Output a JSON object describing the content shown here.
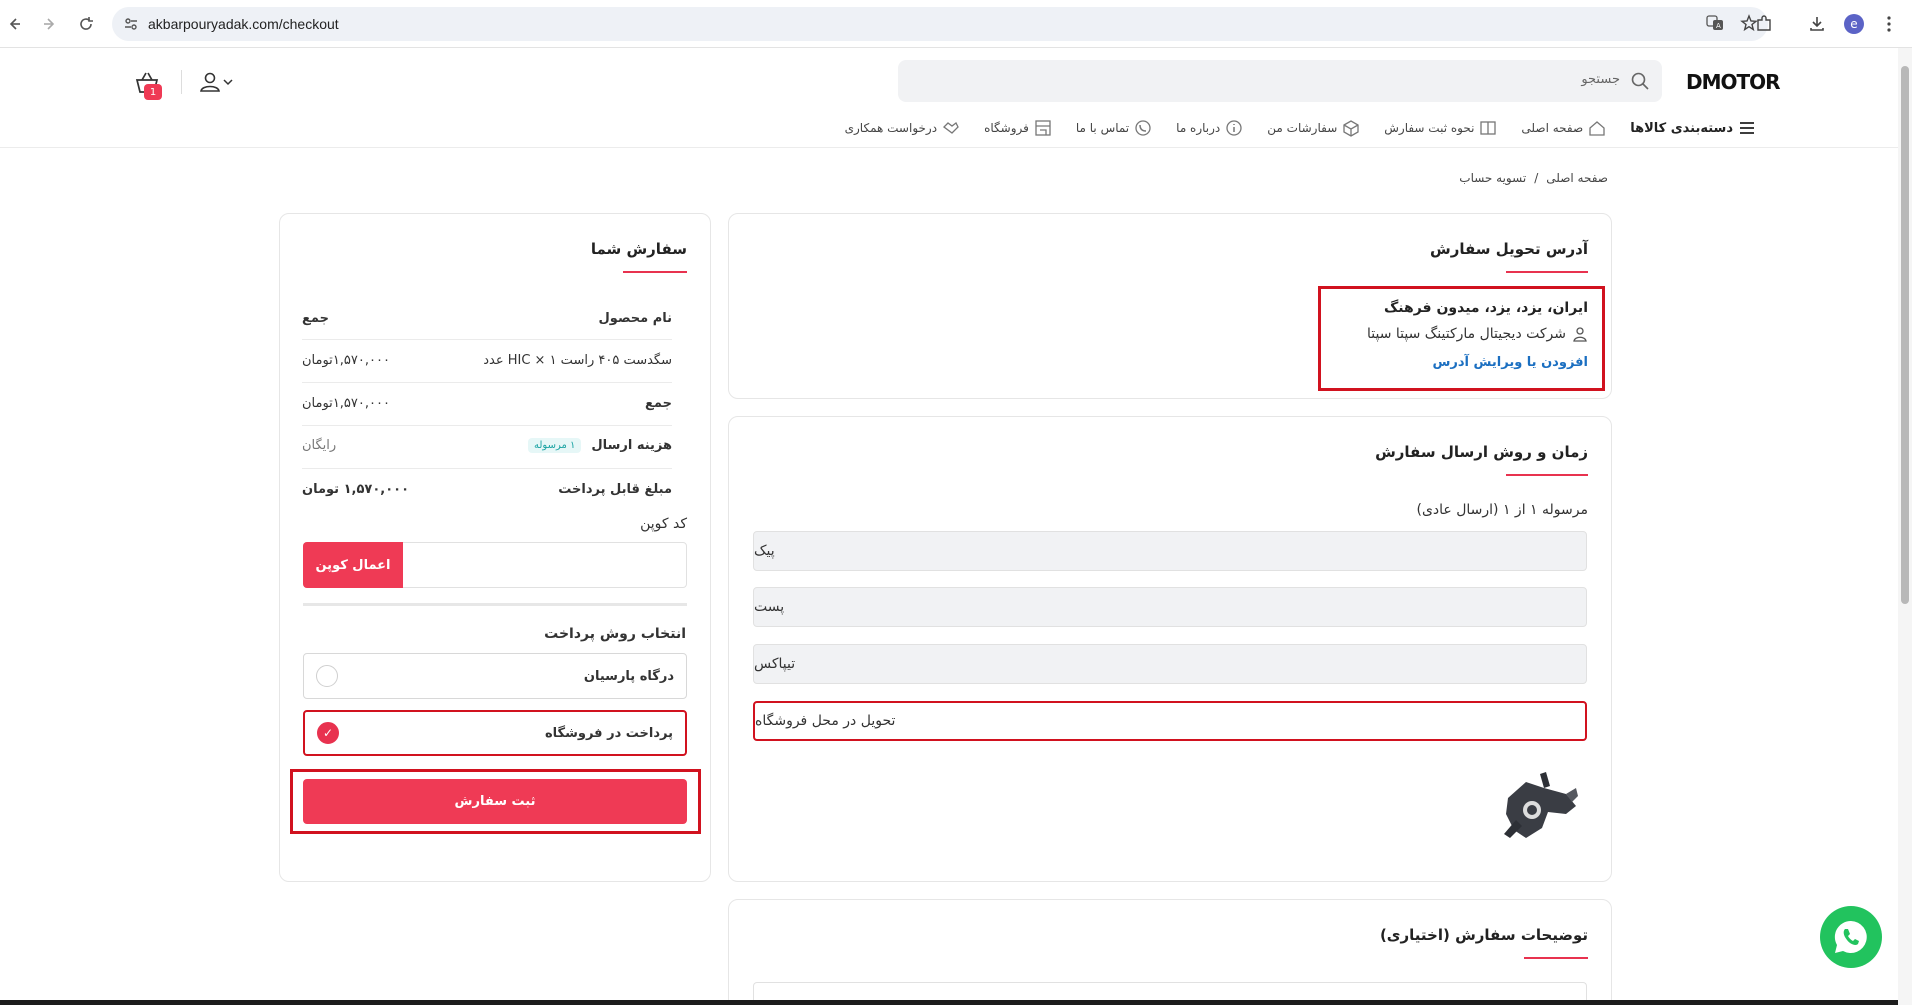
{
  "browser": {
    "url": "akbarpouryadak.com/checkout",
    "profile_initial": "e"
  },
  "header": {
    "logo_text": "DMOTOR",
    "search_placeholder": "جستجو",
    "cart_count": "1"
  },
  "menu": {
    "categories": "دسته‌بندی کالاها",
    "items": [
      {
        "label": "صفحه اصلی",
        "icon": "home-icon"
      },
      {
        "label": "نحوه ثبت سفارش",
        "icon": "book-icon"
      },
      {
        "label": "سفارشات من",
        "icon": "box-icon"
      },
      {
        "label": "درباره ما",
        "icon": "info-icon"
      },
      {
        "label": "تماس با ما",
        "icon": "phone-icon"
      },
      {
        "label": "فروشگاه",
        "icon": "store-icon"
      },
      {
        "label": "درخواست همکاری",
        "icon": "handshake-icon"
      }
    ]
  },
  "breadcrumb": {
    "home": "صفحه اصلی",
    "separator": "/",
    "current": "تسویه حساب"
  },
  "address": {
    "title": "آدرس تحویل سفارش",
    "line1": "ایران، یزد، یزد، میدون فرهنگ",
    "recipient": "شرکت دیجیتال مارکتینگ سپتا سپتا",
    "edit_link": "افزودن یا ویرایش آدرس"
  },
  "shipping": {
    "title": "زمان و روش ارسال سفارش",
    "shipment_label": "مرسوله ۱ از ۱ (ارسال عادی)",
    "options": [
      "پیک",
      "پست",
      "تیپاکس",
      "تحویل در محل فروشگاه"
    ],
    "selected_index": 3
  },
  "notes": {
    "title": "توضیحات سفارش (اختیاری)"
  },
  "order": {
    "title": "سفارش شما",
    "header": {
      "product": "نام محصول",
      "total": "جمع"
    },
    "product": {
      "name": "سگدست ۴۰۵ راست HIC × ۱ عدد",
      "price": "۱,۵۷۰,۰۰۰تومان"
    },
    "subtotal": {
      "label": "جمع",
      "value": "۱,۵۷۰,۰۰۰تومان"
    },
    "shipping_cost": {
      "label": "هزینه ارسال",
      "badge": "۱ مرسوله",
      "value": "رایگان"
    },
    "payable": {
      "label": "مبلغ قابل پرداخت",
      "value": "۱,۵۷۰,۰۰۰ تومان"
    },
    "coupon_label": "کد کوپن",
    "coupon_button": "اعمال کوپن",
    "payment_title": "انتخاب روش پرداخت",
    "payment_methods": [
      "درگاه پارسیان",
      "پرداخت در فروشگاه"
    ],
    "payment_selected_index": 1,
    "submit": "ثبت سفارش"
  },
  "colors": {
    "accent": "#ef3a55",
    "highlight_frame": "#d1121f",
    "link": "#1b6fc1",
    "whatsapp": "#22c35e"
  }
}
